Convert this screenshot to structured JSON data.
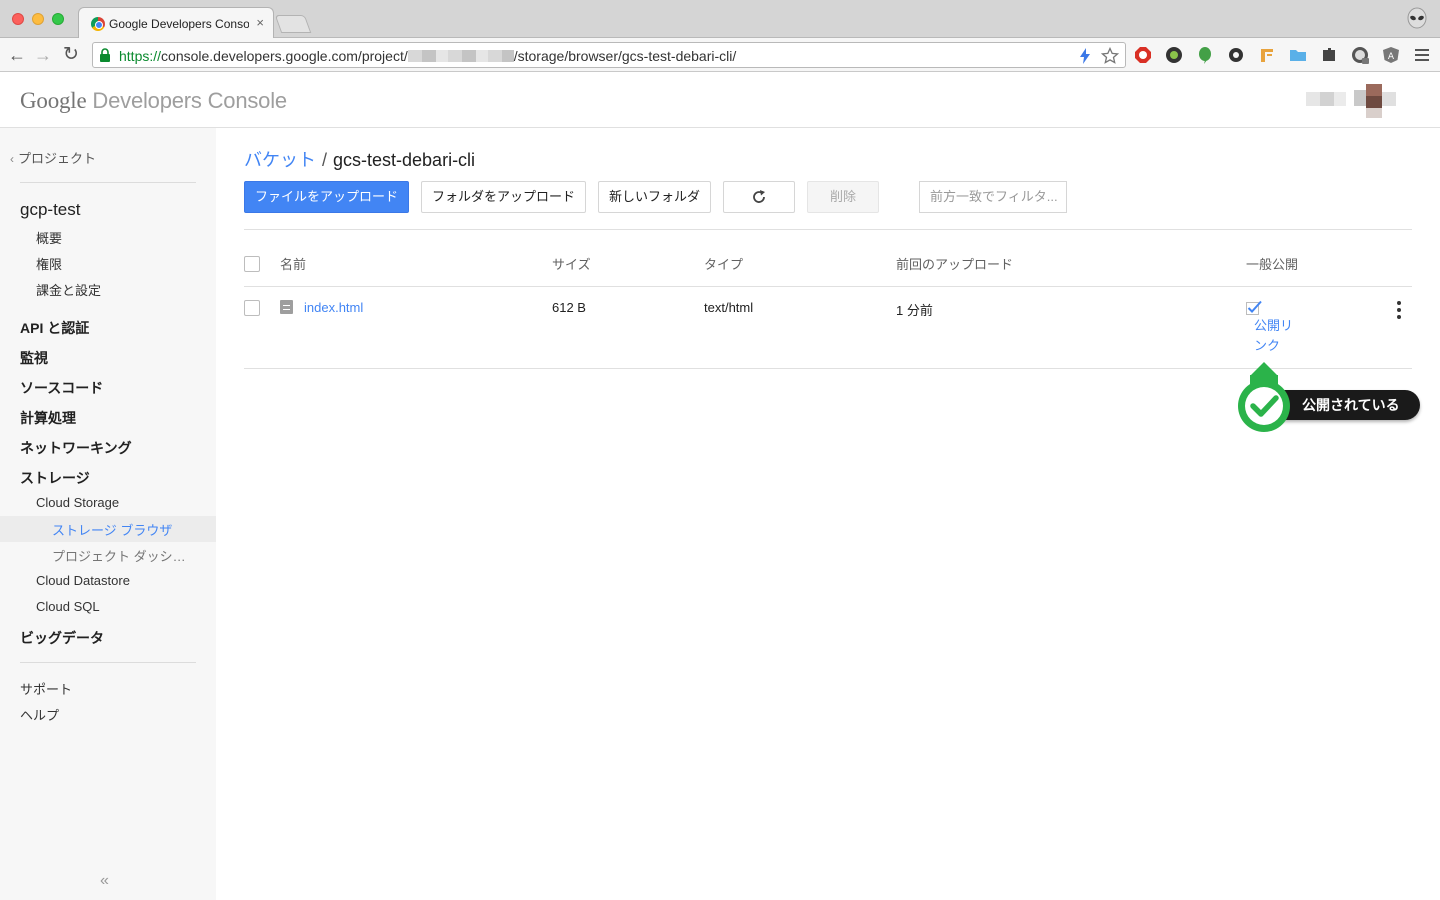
{
  "browser": {
    "tab_title": "Google Developers Console",
    "tab_close": "×",
    "url_scheme": "https://",
    "url_host": "console.developers.google.com/project/",
    "url_path": "/storage/browser/gcs-test-debari-cli/"
  },
  "header": {
    "logo_google": "Google",
    "logo_rest": " Developers Console"
  },
  "sidebar": {
    "back_label": "プロジェクト",
    "project_name": "gcp-test",
    "project_items": [
      "概要",
      "権限",
      "課金と設定"
    ],
    "sections": [
      "API と認証",
      "監視",
      "ソースコード",
      "計算処理",
      "ネットワーキング",
      "ストレージ"
    ],
    "storage_items": [
      "Cloud Storage",
      "ストレージ ブラウザ",
      "プロジェクト ダッシ…",
      "Cloud Datastore",
      "Cloud SQL"
    ],
    "bigdata": "ビッグデータ",
    "footer_items": [
      "サポート",
      "ヘルプ"
    ],
    "collapse": "«"
  },
  "breadcrumb": {
    "parent": "バケット",
    "separator": "/",
    "current": "gcs-test-debari-cli"
  },
  "actions": {
    "upload_file": "ファイルをアップロード",
    "upload_folder": "フォルダをアップロード",
    "new_folder": "新しいフォルダ",
    "delete": "削除",
    "filter_placeholder": "前方一致でフィルタ..."
  },
  "table": {
    "columns": [
      "名前",
      "サイズ",
      "タイプ",
      "前回のアップロード",
      "一般公開"
    ],
    "rows": [
      {
        "name": "index.html",
        "size": "612 B",
        "type": "text/html",
        "uploaded": "1 分前",
        "public": true,
        "public_link_line1": "公開リ",
        "public_link_line2": "ンク"
      }
    ]
  },
  "annotation": {
    "label": "公開されている",
    "color": "#2bb34a"
  },
  "colors": {
    "primary": "#4285f4",
    "link": "#4285f4"
  }
}
